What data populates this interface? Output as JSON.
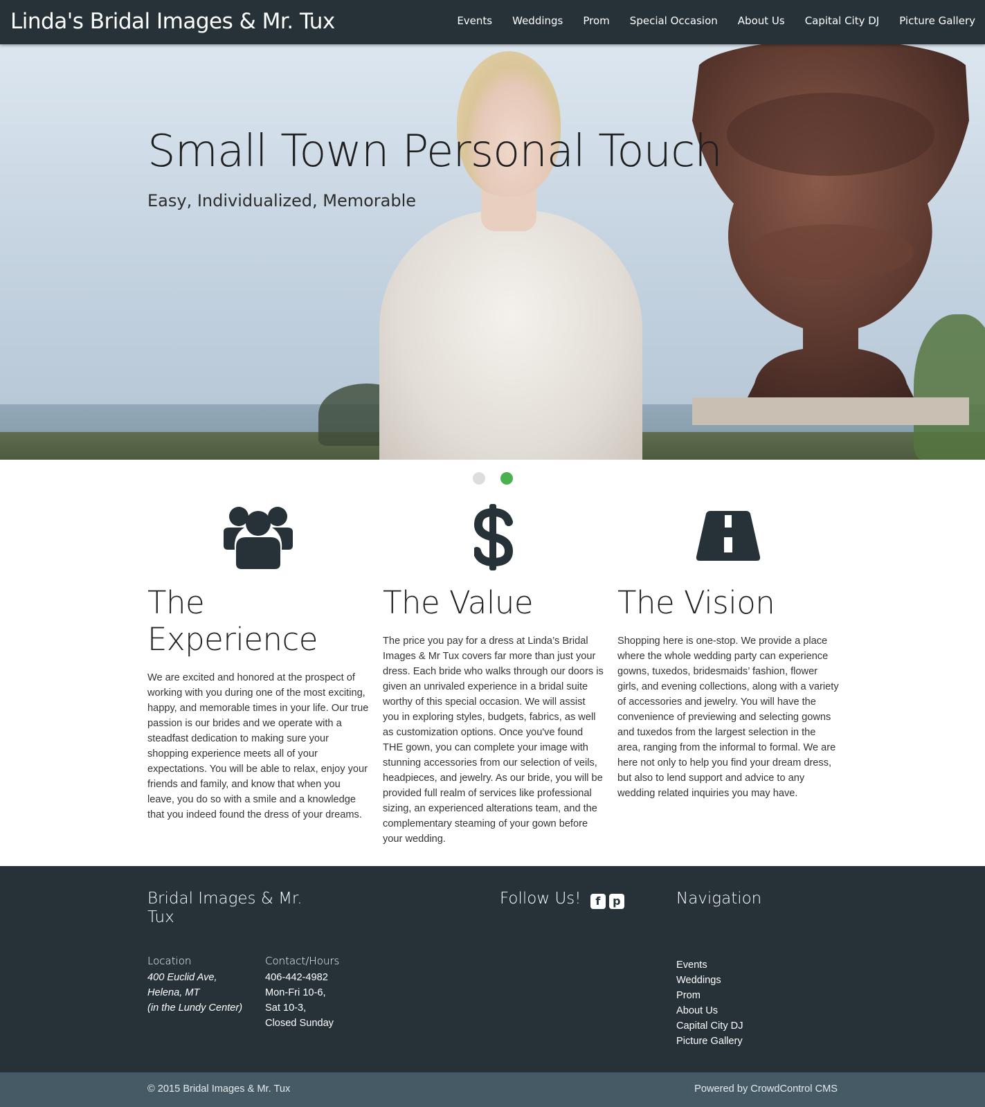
{
  "header": {
    "brand": "Linda's Bridal Images & Mr. Tux",
    "nav": [
      "Events",
      "Weddings",
      "Prom",
      "Special Occasion",
      "About Us",
      "Capital City DJ",
      "Picture Gallery"
    ]
  },
  "hero": {
    "title": "Small Town Personal Touch",
    "subtitle": "Easy, Individualized, Memorable",
    "slides": 2,
    "active_slide": 2
  },
  "features": [
    {
      "icon": "users-icon",
      "title": "The Experience",
      "text": "We are excited and honored at the prospect of working with you during one of the most exciting, happy, and memorable times in your life. Our true passion is our brides and we operate with a steadfast dedication to making sure your shopping experience meets all of your expectations. You will be able to relax, enjoy your friends and family, and know that when you leave, you do so with a smile and a knowledge that you indeed found the dress of your dreams."
    },
    {
      "icon": "dollar-icon",
      "title": "The Value",
      "text": "The price you pay for a dress at Linda’s Bridal Images & Mr Tux covers far more than just your dress. Each bride who walks through our doors is given an unrivaled experience in a bridal suite worthy of this special occasion. We will assist you in exploring styles, budgets, fabrics, as well as customization options. Once you've found THE gown, you can complete your image with stunning accessories from our selection of veils, headpieces, and jewelry. As our bride, you will be provided full realm of services like professional sizing, an experienced alterations team, and the complementary steaming of your gown before your wedding."
    },
    {
      "icon": "road-icon",
      "title": "The Vision",
      "text": "Shopping here is one-stop. We provide a place where the whole wedding party can experience gowns, tuxedos, bridesmaids’ fashion, flower girls, and evening collections, along with a variety of accessories and jewelry. You will have the convenience of previewing and selecting gowns and tuxedos from the largest selection in the area, ranging from the informal to formal. We are here not only to help you find your dream dress, but also to lend support and advice to any wedding related inquiries you may have."
    }
  ],
  "footer": {
    "brand": "Bridal Images & Mr. Tux",
    "follow": "Follow Us!",
    "social": [
      "facebook-icon",
      "pinterest-icon"
    ],
    "location_label": "Location",
    "location": [
      "400 Euclid Ave,",
      "Helena, MT",
      "(in the Lundy Center)"
    ],
    "contact_label": "Contact/Hours",
    "contact": [
      "406-442-4982",
      "Mon-Fri 10-6,",
      "Sat 10-3,",
      "Closed Sunday"
    ],
    "nav_title": "Navigation",
    "nav": [
      "Events",
      "Weddings",
      "Prom",
      "About Us",
      "Capital City DJ",
      "Picture Gallery"
    ]
  },
  "bottom": {
    "copyright": "© 2015 Bridal Images & Mr. Tux",
    "powered": "Powered by CrowdControl CMS"
  },
  "colors": {
    "header_bg": "#263238",
    "bottom_bg": "#455a64",
    "accent": "#4caf50",
    "icon": "#263238"
  }
}
